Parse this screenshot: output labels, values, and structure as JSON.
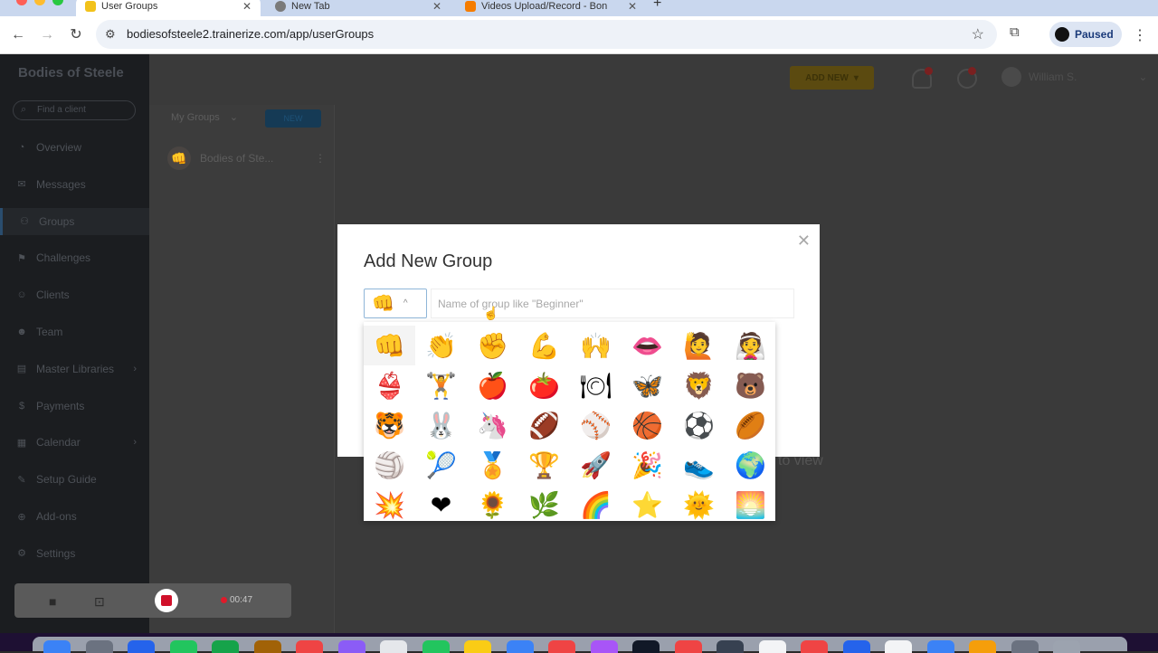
{
  "browser": {
    "tabs": [
      {
        "label": "User Groups",
        "favicon_color": "#f2c21b",
        "active": true
      },
      {
        "label": "New Tab",
        "favicon_color": "#7a7a7a",
        "active": false
      },
      {
        "label": "Videos Upload/Record - Bon",
        "favicon_color": "#f57c00",
        "active": false
      }
    ],
    "new_tab_symbol": "+",
    "close_symbol": "✕",
    "url": "bodiesofsteele2.trainerize.com/app/userGroups",
    "profile_label": "Paused",
    "icons": {
      "back": "←",
      "forward": "→",
      "reload": "↻",
      "site_info": "⚙",
      "bookmark": "☆",
      "extensions": "⧉",
      "menu": "⋮"
    }
  },
  "sidebar": {
    "brand": "Bodies of Steele",
    "search_placeholder": "Find a client",
    "items": [
      {
        "label": "Overview",
        "icon": "◔",
        "has_chevron": false
      },
      {
        "label": "Messages",
        "icon": "✉",
        "has_chevron": false
      },
      {
        "label": "Groups",
        "icon": "⚇",
        "has_chevron": false,
        "active": true
      },
      {
        "label": "Challenges",
        "icon": "⚑",
        "has_chevron": false
      },
      {
        "label": "Clients",
        "icon": "☺",
        "has_chevron": false
      },
      {
        "label": "Team",
        "icon": "☻",
        "has_chevron": false
      },
      {
        "label": "Master Libraries",
        "icon": "▤",
        "has_chevron": true
      },
      {
        "label": "Payments",
        "icon": "$",
        "has_chevron": false
      },
      {
        "label": "Calendar",
        "icon": "▦",
        "has_chevron": true
      },
      {
        "label": "Setup Guide",
        "icon": "✎",
        "has_chevron": false
      },
      {
        "label": "Add-ons",
        "icon": "⊕",
        "has_chevron": false
      },
      {
        "label": "Settings",
        "icon": "⚙",
        "has_chevron": false
      }
    ],
    "chevron": "›"
  },
  "header": {
    "add_new_label": "ADD NEW",
    "add_new_caret": "▾",
    "user_name": "William S.",
    "user_caret": "⌄"
  },
  "groups_panel": {
    "filter_label": "My Groups",
    "filter_caret": "⌄",
    "new_button": "NEW",
    "groups": [
      {
        "name": "Bodies of Ste...",
        "icon": "👊",
        "menu": "⋮"
      }
    ]
  },
  "background_text": "to view",
  "modal": {
    "title": "Add New Group",
    "close_symbol": "✕",
    "selected_icon": "👊",
    "select_caret": "^",
    "name_placeholder": "Name of group like \"Beginner\"",
    "name_value": "",
    "emojis": [
      "👊",
      "👏",
      "✊",
      "💪",
      "🙌",
      "👄",
      "🙋",
      "👰",
      "👙",
      "🏋",
      "🍎",
      "🍅",
      "🍽",
      "🦋",
      "🦁",
      "🐻",
      "🐯",
      "🐰",
      "🦄",
      "🏈",
      "⚾",
      "🏀",
      "⚽",
      "🏉",
      "🏐",
      "🎾",
      "🏅",
      "🏆",
      "🚀",
      "🎉",
      "👟",
      "🌍",
      "💥",
      "❤",
      "🌻",
      "🌿",
      "🌈",
      "⭐",
      "🌞",
      "🌅"
    ]
  },
  "cursor_symbol": "☝",
  "recorder": {
    "time": "00:47",
    "camera_icon": "■",
    "screen_icon": "⊡"
  },
  "dock_colors": [
    "#3b82f6",
    "#6b7280",
    "#2563eb",
    "#22c55e",
    "#16a34a",
    "#a16207",
    "#ef4444",
    "#8b5cf6",
    "#e5e7eb",
    "#22c55e",
    "#facc15",
    "#3b82f6",
    "#ef4444",
    "#a855f7",
    "#111827",
    "#ef4444",
    "#374151",
    "#f3f4f6",
    "#ef4444",
    "#2563eb",
    "#f3f4f6",
    "#3b82f6",
    "#f59e0b",
    "#6b7280",
    "#9ca3af"
  ]
}
